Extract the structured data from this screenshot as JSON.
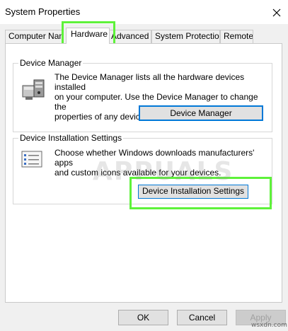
{
  "window": {
    "title": "System Properties",
    "close_icon": "close-icon"
  },
  "tabs": [
    {
      "label": "Computer Name",
      "active": false
    },
    {
      "label": "Hardware",
      "active": true
    },
    {
      "label": "Advanced",
      "active": false
    },
    {
      "label": "System Protection",
      "active": false
    },
    {
      "label": "Remote",
      "active": false
    }
  ],
  "device_manager": {
    "group_title": "Device Manager",
    "icon": "device-manager-icon",
    "description": [
      "The Device Manager lists all the hardware devices installed",
      "on your computer. Use the Device Manager to change the",
      "properties of any device."
    ],
    "button_label": "Device Manager"
  },
  "device_installation": {
    "group_title": "Device Installation Settings",
    "icon": "installation-settings-icon",
    "description": [
      "Choose whether Windows downloads manufacturers' apps",
      "and custom icons available for your devices."
    ],
    "button_label": "Device Installation Settings"
  },
  "footer": {
    "ok_label": "OK",
    "cancel_label": "Cancel",
    "apply_label": "Apply"
  },
  "overlays": {
    "watermark_text": "APPUALS",
    "credit_text": "wsxdn.com",
    "highlight_color": "#5ef23a",
    "accent_color": "#0078d7"
  }
}
